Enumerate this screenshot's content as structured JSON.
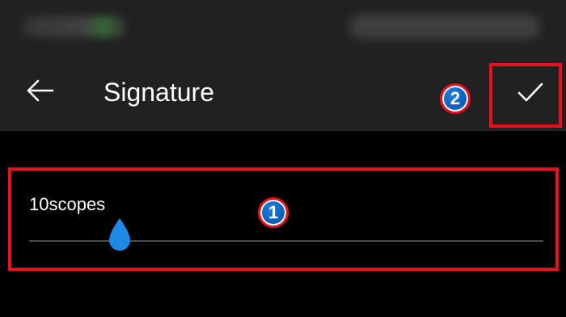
{
  "app": {
    "title": "Signature",
    "colors": {
      "appbar_background": "#212121",
      "page_background": "#000000",
      "accent": "#1e88e5",
      "highlight": "#e8101c"
    }
  },
  "toolbar": {
    "back_icon": "arrow-left-icon",
    "confirm_icon": "checkmark-icon"
  },
  "slider": {
    "value_label": "10scopes",
    "thumb_icon": "teardrop-thumb-icon"
  },
  "annotations": {
    "step1": "1",
    "step2": "2"
  }
}
